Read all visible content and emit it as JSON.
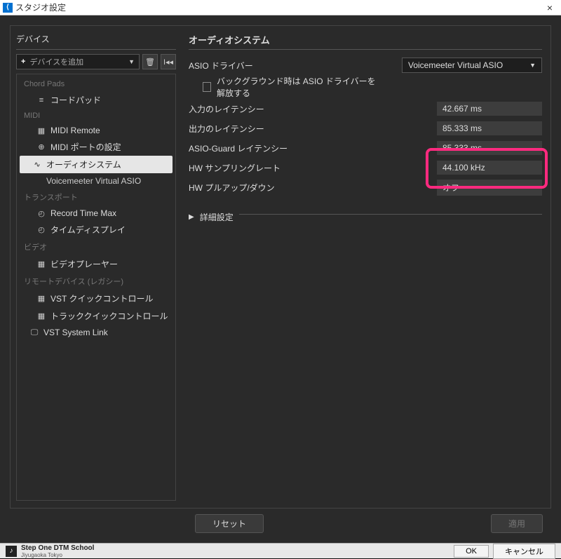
{
  "titlebar": {
    "title": "スタジオ設定"
  },
  "sidebar": {
    "header": "デバイス",
    "add_placeholder": "デバイスを追加",
    "groups": {
      "chord": {
        "label": "Chord Pads",
        "items": [
          {
            "label": "コードパッド"
          }
        ]
      },
      "midi": {
        "label": "MIDI",
        "items": [
          {
            "label": "MIDI Remote"
          },
          {
            "label": "MIDI ポートの設定"
          }
        ]
      },
      "audio": {
        "items": [
          {
            "label": "オーディオシステム"
          },
          {
            "label": "Voicemeeter Virtual ASIO"
          }
        ]
      },
      "transport": {
        "label": "トランスポート",
        "items": [
          {
            "label": "Record Time Max"
          },
          {
            "label": "タイムディスプレイ"
          }
        ]
      },
      "video": {
        "label": "ビデオ",
        "items": [
          {
            "label": "ビデオプレーヤー"
          }
        ]
      },
      "remote": {
        "label": "リモートデバイス (レガシー)",
        "items": [
          {
            "label": "VST クイックコントロール"
          },
          {
            "label": "トラッククイックコントロール"
          }
        ]
      },
      "vst": {
        "label": "VST System Link"
      }
    }
  },
  "main": {
    "title": "オーディオシステム",
    "driver": {
      "label": "ASIO ドライバー",
      "value": "Voicemeeter Virtual ASIO"
    },
    "bg_release": "バックグラウンド時は ASIO ドライバーを解放する",
    "rows": {
      "in_lat": {
        "label": "入力のレイテンシー",
        "value": "42.667 ms"
      },
      "out_lat": {
        "label": "出力のレイテンシー",
        "value": "85.333 ms"
      },
      "guard": {
        "label": "ASIO-Guard レイテンシー",
        "value": "85.333 ms"
      },
      "srate": {
        "label": "HW サンプリングレート",
        "value": "44.100 kHz"
      },
      "pull": {
        "label": "HW プルアップ/ダウン",
        "value": "オフ"
      }
    },
    "adv": "詳細設定",
    "reset": "リセット",
    "apply": "適用"
  },
  "osbar": {
    "brand": "Step One DTM School",
    "brand_sub": "Jiyugaoka Tokyo",
    "ok": "OK",
    "cancel": "キャンセル"
  }
}
